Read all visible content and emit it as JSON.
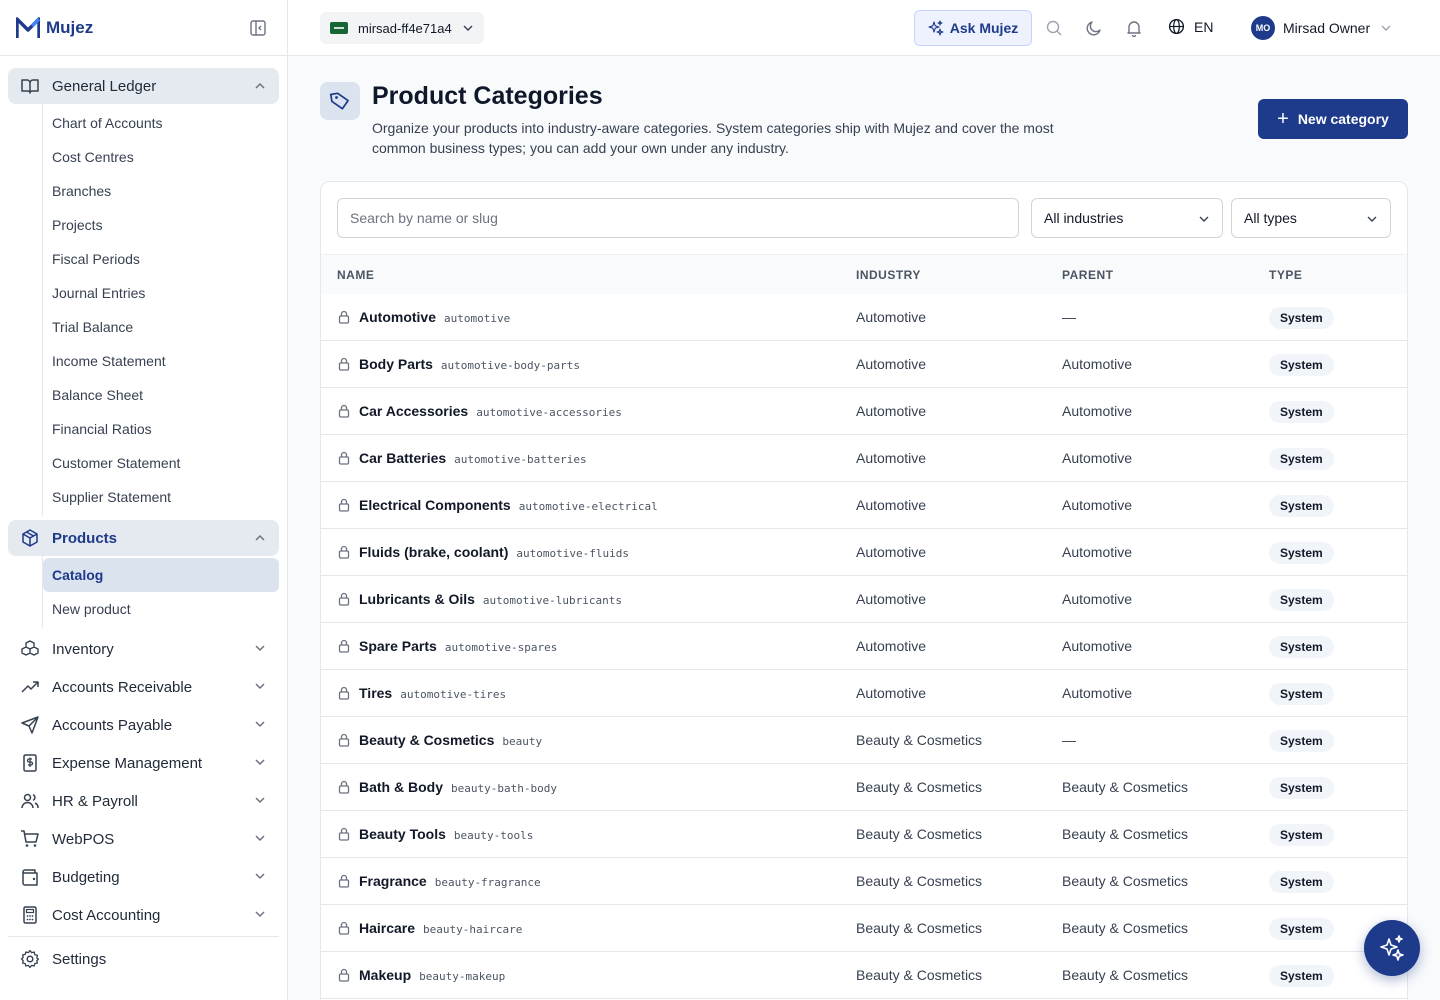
{
  "app": {
    "name": "Mujez"
  },
  "topbar": {
    "company": "mirsad-ff4e71a4",
    "ask_label": "Ask Mujez",
    "language": "EN",
    "user_initials": "MO",
    "user_name": "Mirsad Owner"
  },
  "sidebar": {
    "general_ledger": {
      "label": "General Ledger",
      "items": [
        "Chart of Accounts",
        "Cost Centres",
        "Branches",
        "Projects",
        "Fiscal Periods",
        "Journal Entries",
        "Trial Balance",
        "Income Statement",
        "Balance Sheet",
        "Financial Ratios",
        "Customer Statement",
        "Supplier Statement"
      ]
    },
    "products": {
      "label": "Products",
      "items": [
        "Catalog",
        "New product"
      ]
    },
    "groups": [
      {
        "label": "Inventory",
        "icon": "boxes-icon"
      },
      {
        "label": "Accounts Receivable",
        "icon": "trending-up-icon"
      },
      {
        "label": "Accounts Payable",
        "icon": "send-icon"
      },
      {
        "label": "Expense Management",
        "icon": "receipt-icon"
      },
      {
        "label": "HR & Payroll",
        "icon": "users-icon"
      },
      {
        "label": "WebPOS",
        "icon": "cart-icon"
      },
      {
        "label": "Budgeting",
        "icon": "wallet-icon"
      },
      {
        "label": "Cost Accounting",
        "icon": "calculator-icon"
      }
    ],
    "settings": "Settings"
  },
  "page": {
    "title": "Product Categories",
    "description": "Organize your products into industry-aware categories. System categories ship with Mujez and cover the most common business types; you can add your own under any industry.",
    "new_button": "New category"
  },
  "filters": {
    "search_placeholder": "Search by name or slug",
    "industry": "All industries",
    "type": "All types"
  },
  "table": {
    "headers": {
      "name": "NAME",
      "industry": "INDUSTRY",
      "parent": "PARENT",
      "type": "TYPE"
    },
    "rows": [
      {
        "name": "Automotive",
        "slug": "automotive",
        "industry": "Automotive",
        "parent": "—",
        "type": "System"
      },
      {
        "name": "Body Parts",
        "slug": "automotive-body-parts",
        "industry": "Automotive",
        "parent": "Automotive",
        "type": "System"
      },
      {
        "name": "Car Accessories",
        "slug": "automotive-accessories",
        "industry": "Automotive",
        "parent": "Automotive",
        "type": "System"
      },
      {
        "name": "Car Batteries",
        "slug": "automotive-batteries",
        "industry": "Automotive",
        "parent": "Automotive",
        "type": "System"
      },
      {
        "name": "Electrical Components",
        "slug": "automotive-electrical",
        "industry": "Automotive",
        "parent": "Automotive",
        "type": "System"
      },
      {
        "name": "Fluids (brake, coolant)",
        "slug": "automotive-fluids",
        "industry": "Automotive",
        "parent": "Automotive",
        "type": "System"
      },
      {
        "name": "Lubricants & Oils",
        "slug": "automotive-lubricants",
        "industry": "Automotive",
        "parent": "Automotive",
        "type": "System"
      },
      {
        "name": "Spare Parts",
        "slug": "automotive-spares",
        "industry": "Automotive",
        "parent": "Automotive",
        "type": "System"
      },
      {
        "name": "Tires",
        "slug": "automotive-tires",
        "industry": "Automotive",
        "parent": "Automotive",
        "type": "System"
      },
      {
        "name": "Beauty & Cosmetics",
        "slug": "beauty",
        "industry": "Beauty & Cosmetics",
        "parent": "—",
        "type": "System"
      },
      {
        "name": "Bath & Body",
        "slug": "beauty-bath-body",
        "industry": "Beauty & Cosmetics",
        "parent": "Beauty & Cosmetics",
        "type": "System"
      },
      {
        "name": "Beauty Tools",
        "slug": "beauty-tools",
        "industry": "Beauty & Cosmetics",
        "parent": "Beauty & Cosmetics",
        "type": "System"
      },
      {
        "name": "Fragrance",
        "slug": "beauty-fragrance",
        "industry": "Beauty & Cosmetics",
        "parent": "Beauty & Cosmetics",
        "type": "System"
      },
      {
        "name": "Haircare",
        "slug": "beauty-haircare",
        "industry": "Beauty & Cosmetics",
        "parent": "Beauty & Cosmetics",
        "type": "System"
      },
      {
        "name": "Makeup",
        "slug": "beauty-makeup",
        "industry": "Beauty & Cosmetics",
        "parent": "Beauty & Cosmetics",
        "type": "System"
      }
    ]
  },
  "colors": {
    "brand": "#1e3a8a",
    "active_bg": "#dbe3ee"
  }
}
